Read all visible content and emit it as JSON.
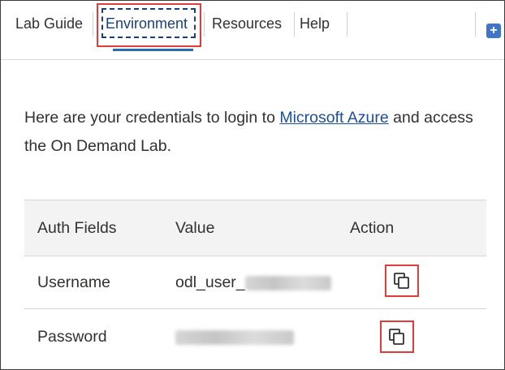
{
  "tabs": [
    {
      "label": "Lab Guide"
    },
    {
      "label": "Environment",
      "active": true
    },
    {
      "label": "Resources"
    },
    {
      "label": "Help"
    }
  ],
  "side_icon": "plus-square-icon",
  "intro": {
    "text_before": "Here are your credentials to login to ",
    "link_text": "Microsoft Azure",
    "text_after": " and access the On Demand Lab."
  },
  "credentials_table": {
    "headers": [
      "Auth Fields",
      "Value",
      "Action"
    ],
    "rows": [
      {
        "field": "Username",
        "value_visible": "odl_user_",
        "value_obscured": true,
        "action_icon": "copy-icon"
      },
      {
        "field": "Password",
        "value_visible": "",
        "value_obscured": true,
        "action_icon": "copy-icon"
      }
    ]
  },
  "colors": {
    "active_tab": "#1b3f7a",
    "link": "#1b4f9c",
    "highlight": "#e13c3c",
    "header_bg": "#f3f3f3"
  }
}
